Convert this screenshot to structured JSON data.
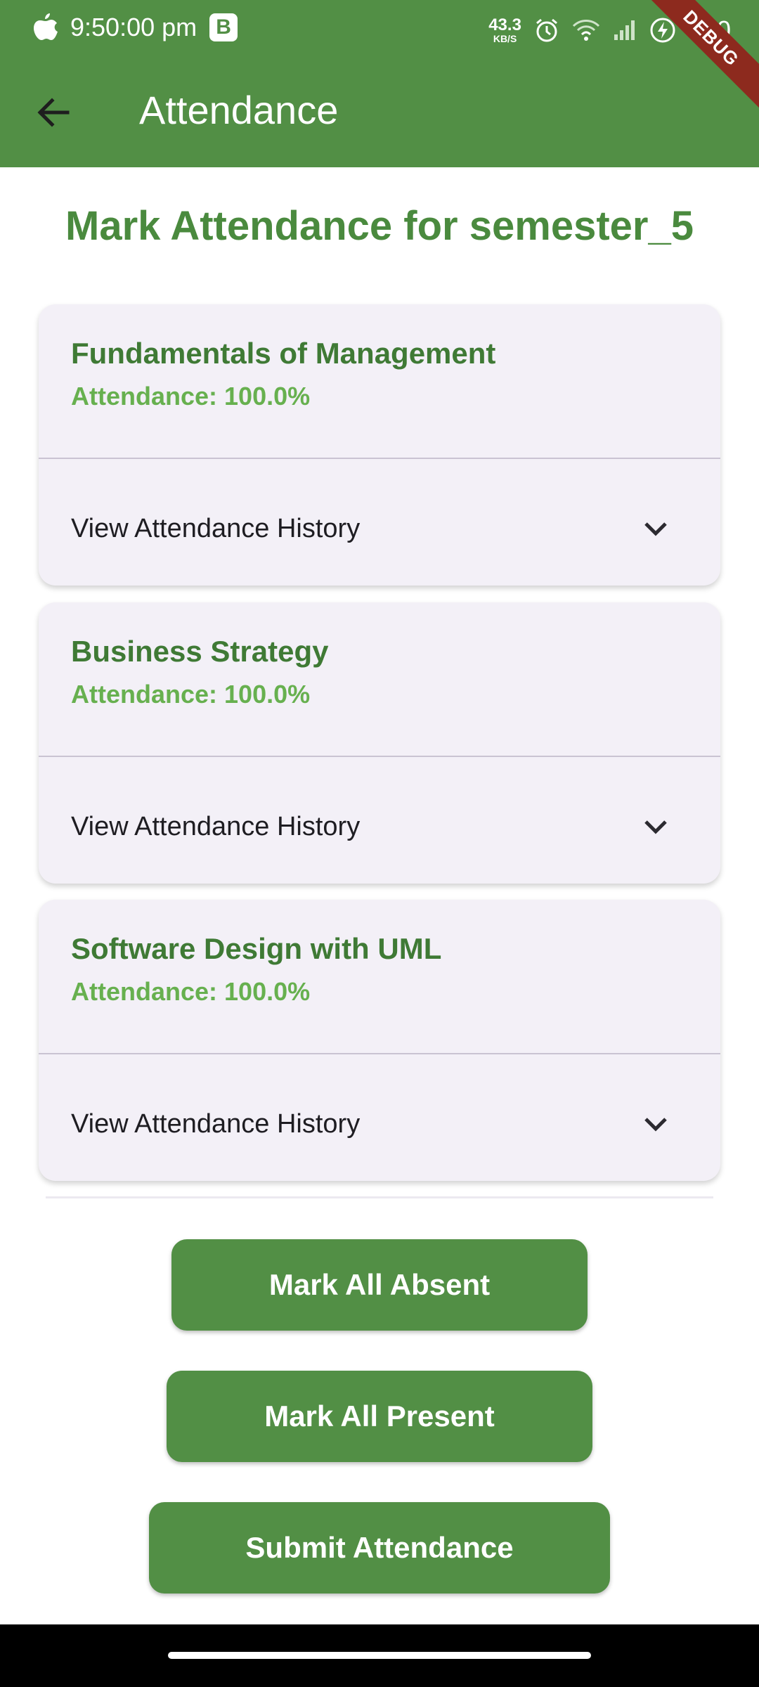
{
  "status_bar": {
    "time": "9:50:00 pm",
    "app_badge": "B",
    "speed_value": "43.3",
    "speed_unit": "KB/S",
    "battery": "100"
  },
  "debug_banner": "DEBUG",
  "app_bar": {
    "title": "Attendance"
  },
  "page": {
    "heading": "Mark Attendance for semester_5"
  },
  "subjects": [
    {
      "name": "Fundamentals of Management",
      "attendance": "Attendance: 100.0%",
      "history_label": "View Attendance History"
    },
    {
      "name": "Business Strategy",
      "attendance": "Attendance: 100.0%",
      "history_label": "View Attendance History"
    },
    {
      "name": "Software Design with UML",
      "attendance": "Attendance: 100.0%",
      "history_label": "View Attendance History"
    }
  ],
  "actions": {
    "mark_absent": "Mark All Absent",
    "mark_present": "Mark All Present",
    "submit": "Submit Attendance"
  },
  "colors": {
    "primary": "#528f45",
    "heading": "#4a8a3e",
    "percent": "#67b04f",
    "card_bg": "#f3f0f7",
    "debug": "#8d2a1e"
  },
  "icons": {
    "back": "arrow-left-icon",
    "expand": "chevron-down-icon"
  }
}
